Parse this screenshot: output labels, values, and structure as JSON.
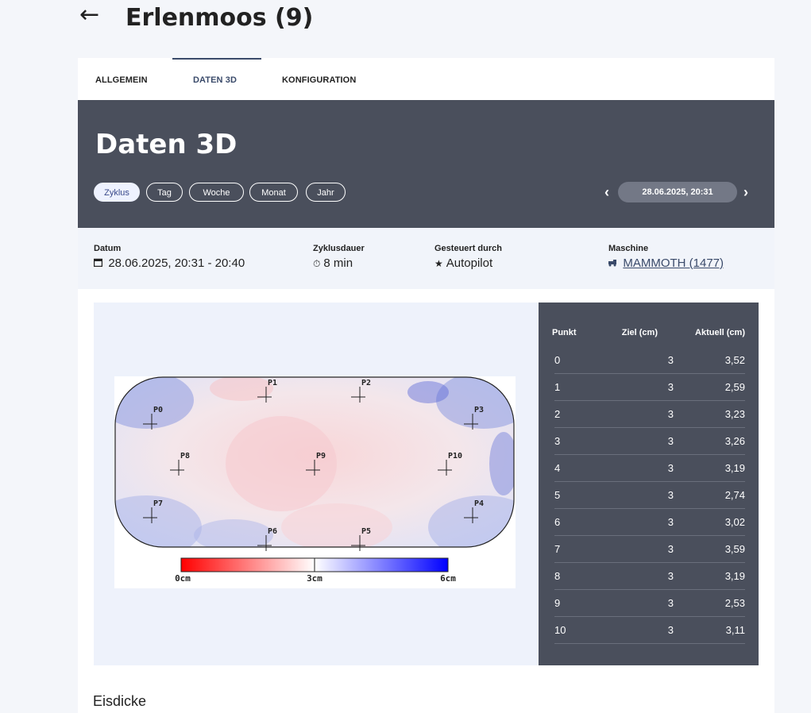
{
  "header": {
    "back_glyph": "←",
    "title": "Erlenmoos (9)"
  },
  "tabs": [
    {
      "label": "ALLGEMEIN"
    },
    {
      "label": "DATEN 3D"
    },
    {
      "label": "KONFIGURATION"
    }
  ],
  "hero": {
    "title": "Daten 3D",
    "periods": [
      "Zyklus",
      "Tag",
      "Woche",
      "Monat",
      "Jahr"
    ],
    "date": "28.06.2025, 20:31",
    "prev_glyph": "‹",
    "next_glyph": "›"
  },
  "info": {
    "datum": {
      "label": "Datum",
      "icon": "calendar-icon",
      "value": "28.06.2025, 20:31 - 20:40"
    },
    "dauer": {
      "label": "Zyklusdauer",
      "icon": "timer-icon",
      "value": "8 min"
    },
    "gesteuert": {
      "label": "Gesteuert durch",
      "icon": "star-icon",
      "value": "Autopilot"
    },
    "maschine": {
      "label": "Maschine",
      "icon": "vehicle-icon",
      "value": "MAMMOTH (1477)"
    }
  },
  "map": {
    "points": [
      "P0",
      "P1",
      "P2",
      "P3",
      "P4",
      "P5",
      "P6",
      "P7",
      "P8",
      "P9",
      "P10"
    ],
    "scale_labels": [
      "0cm",
      "3cm",
      "6cm"
    ]
  },
  "table": {
    "headers": [
      "Punkt",
      "Ziel (cm)",
      "Aktuell (cm)"
    ],
    "rows": [
      [
        "0",
        "3",
        "3,52"
      ],
      [
        "1",
        "3",
        "2,59"
      ],
      [
        "2",
        "3",
        "3,23"
      ],
      [
        "3",
        "3",
        "3,26"
      ],
      [
        "4",
        "3",
        "3,19"
      ],
      [
        "5",
        "3",
        "2,74"
      ],
      [
        "6",
        "3",
        "3,02"
      ],
      [
        "7",
        "3",
        "3,59"
      ],
      [
        "8",
        "3",
        "3,19"
      ],
      [
        "9",
        "3",
        "2,53"
      ],
      [
        "10",
        "3",
        "3,11"
      ]
    ]
  },
  "section": {
    "title": "Eisdicke"
  }
}
